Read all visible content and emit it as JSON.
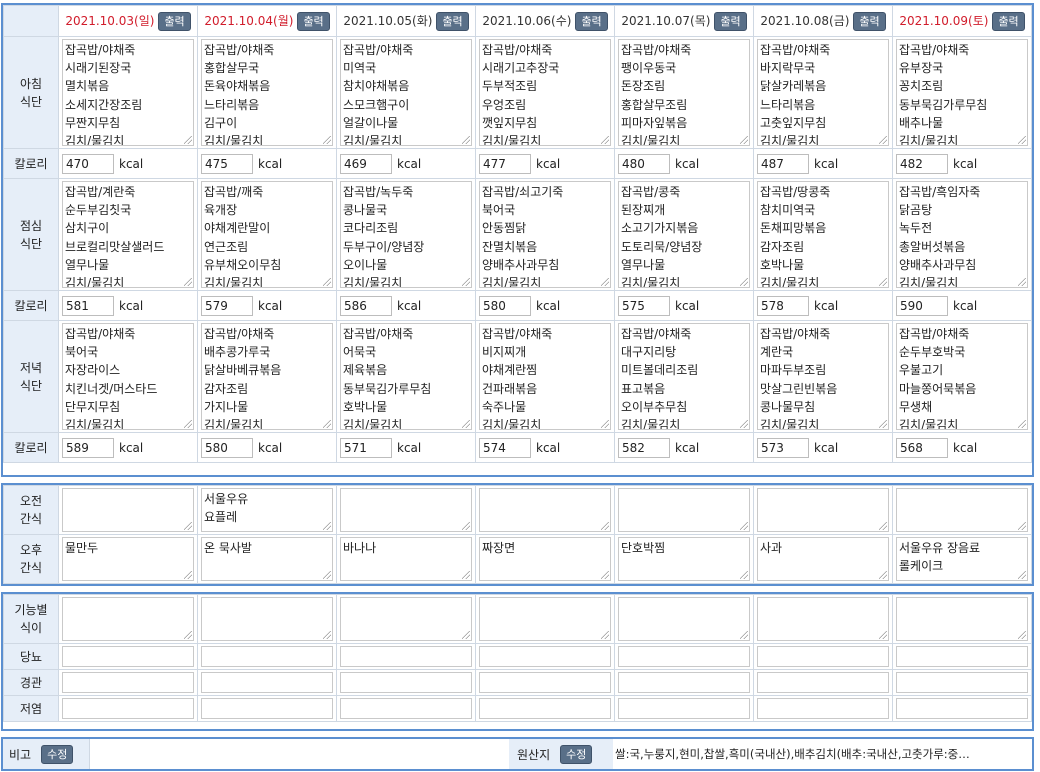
{
  "days": [
    {
      "date": "2021.10.03(일)",
      "red": true
    },
    {
      "date": "2021.10.04(월)",
      "red": true
    },
    {
      "date": "2021.10.05(화)",
      "red": false
    },
    {
      "date": "2021.10.06(수)",
      "red": false
    },
    {
      "date": "2021.10.07(목)",
      "red": false
    },
    {
      "date": "2021.10.08(금)",
      "red": false
    },
    {
      "date": "2021.10.09(토)",
      "red": true
    }
  ],
  "print_label": "출력",
  "labels": {
    "breakfast": [
      "아침",
      "식단"
    ],
    "lunch": [
      "점심",
      "식단"
    ],
    "dinner": [
      "저녁",
      "식단"
    ],
    "calorie": "칼로리",
    "am_snack": [
      "오전",
      "간식"
    ],
    "pm_snack": [
      "오후",
      "간식"
    ],
    "functional": [
      "기능별",
      "식이"
    ],
    "diabetes": "당뇨",
    "tube": "경관",
    "low_salt": "저염"
  },
  "kcal_unit": "kcal",
  "breakfast": [
    [
      "잡곡밥/야채죽",
      "시래기된장국",
      "멸치볶음",
      "소세지간장조림",
      "무짠지무침",
      "김치/물김치"
    ],
    [
      "잡곡밥/야채죽",
      "홍합살무국",
      "돈육야채볶음",
      "느타리볶음",
      "김구이",
      "김치/물김치"
    ],
    [
      "잡곡밥/야채죽",
      "미역국",
      "참치야채볶음",
      "스모크햄구이",
      "얼갈이나물",
      "김치/물김치"
    ],
    [
      "잡곡밥/야채죽",
      "시래기고추장국",
      "두부적조림",
      "우엉조림",
      "깻잎지무침",
      "김치/물김치"
    ],
    [
      "잡곡밥/야채죽",
      "팽이우동국",
      "돈장조림",
      "홍합살무조림",
      "피마자잎볶음",
      "김치/물김치"
    ],
    [
      "잡곡밥/야채죽",
      "바지락무국",
      "닭살카레볶음",
      "느타리볶음",
      "고춧잎지무침",
      "김치/물김치"
    ],
    [
      "잡곡밥/야채죽",
      "유부장국",
      "꽁치조림",
      "동부묵김가루무침",
      "배추나물",
      "김치/물김치"
    ]
  ],
  "breakfast_kcal": [
    "470",
    "475",
    "469",
    "477",
    "480",
    "487",
    "482"
  ],
  "lunch": [
    [
      "잡곡밥/계란죽",
      "순두부김칫국",
      "삼치구이",
      "브로컬리맛살샐러드",
      "열무나물",
      "김치/물김치"
    ],
    [
      "잡곡밥/깨죽",
      "육개장",
      "야채계란말이",
      "연근조림",
      "유부채오이무침",
      "김치/물김치"
    ],
    [
      "잡곡밥/녹두죽",
      "콩나물국",
      "코다리조림",
      "두부구이/양념장",
      "오이나물",
      "김치/물김치"
    ],
    [
      "잡곡밥/쇠고기죽",
      "북어국",
      "안동찜닭",
      "잔멸치볶음",
      "양배추사과무침",
      "김치/물김치"
    ],
    [
      "잡곡밥/콩죽",
      "된장찌개",
      "소고기가지볶음",
      "도토리묵/양념장",
      "열무나물",
      "김치/물김치"
    ],
    [
      "잡곡밥/땅콩죽",
      "참치미역국",
      "돈채피망볶음",
      "감자조림",
      "호박나물",
      "김치/물김치"
    ],
    [
      "잡곡밥/흑임자죽",
      "닭곰탕",
      "녹두전",
      "총알버섯볶음",
      "양배추사과무침",
      "김치/물김치"
    ]
  ],
  "lunch_kcal": [
    "581",
    "579",
    "586",
    "580",
    "575",
    "578",
    "590"
  ],
  "dinner": [
    [
      "잡곡밥/야채죽",
      "북어국",
      "자장라이스",
      "치킨너겟/머스타드",
      "단무지무침",
      "김치/물김치"
    ],
    [
      "잡곡밥/야채죽",
      "배추콩가루국",
      "닭살바베큐볶음",
      "감자조림",
      "가지나물",
      "김치/물김치"
    ],
    [
      "잡곡밥/야채죽",
      "어묵국",
      "제육볶음",
      "동부묵김가루무침",
      "호박나물",
      "김치/물김치"
    ],
    [
      "잡곡밥/야채죽",
      "비지찌개",
      "야채계란찜",
      "건파래볶음",
      "숙주나물",
      "김치/물김치"
    ],
    [
      "잡곡밥/야채죽",
      "대구지리탕",
      "미트볼데리조림",
      "표고볶음",
      "오이부추무침",
      "김치/물김치"
    ],
    [
      "잡곡밥/야채죽",
      "계란국",
      "마파두부조림",
      "맛살그린빈볶음",
      "콩나물무침",
      "김치/물김치"
    ],
    [
      "잡곡밥/야채죽",
      "순두부호박국",
      "우불고기",
      "마늘쫑어묵볶음",
      "무생채",
      "김치/물김치"
    ]
  ],
  "dinner_kcal": [
    "589",
    "580",
    "571",
    "574",
    "582",
    "573",
    "568"
  ],
  "am_snack": [
    [],
    [
      "서울우유",
      "요플레"
    ],
    [],
    [],
    [],
    [],
    []
  ],
  "pm_snack": [
    [
      "물만두"
    ],
    [
      "온 묵사발"
    ],
    [
      "바나나"
    ],
    [
      "짜장면"
    ],
    [
      "단호박찜"
    ],
    [
      "사과"
    ],
    [
      "서울우유 장음료",
      "롤케이크"
    ]
  ],
  "footer": {
    "note_label": "비고",
    "edit_label": "수정",
    "origin_label": "원산지",
    "origin_text": "쌀:국,누룽지,현미,찹쌀,흑미(국내산),배추김치(배추:국내산,고춧가루:중…"
  }
}
